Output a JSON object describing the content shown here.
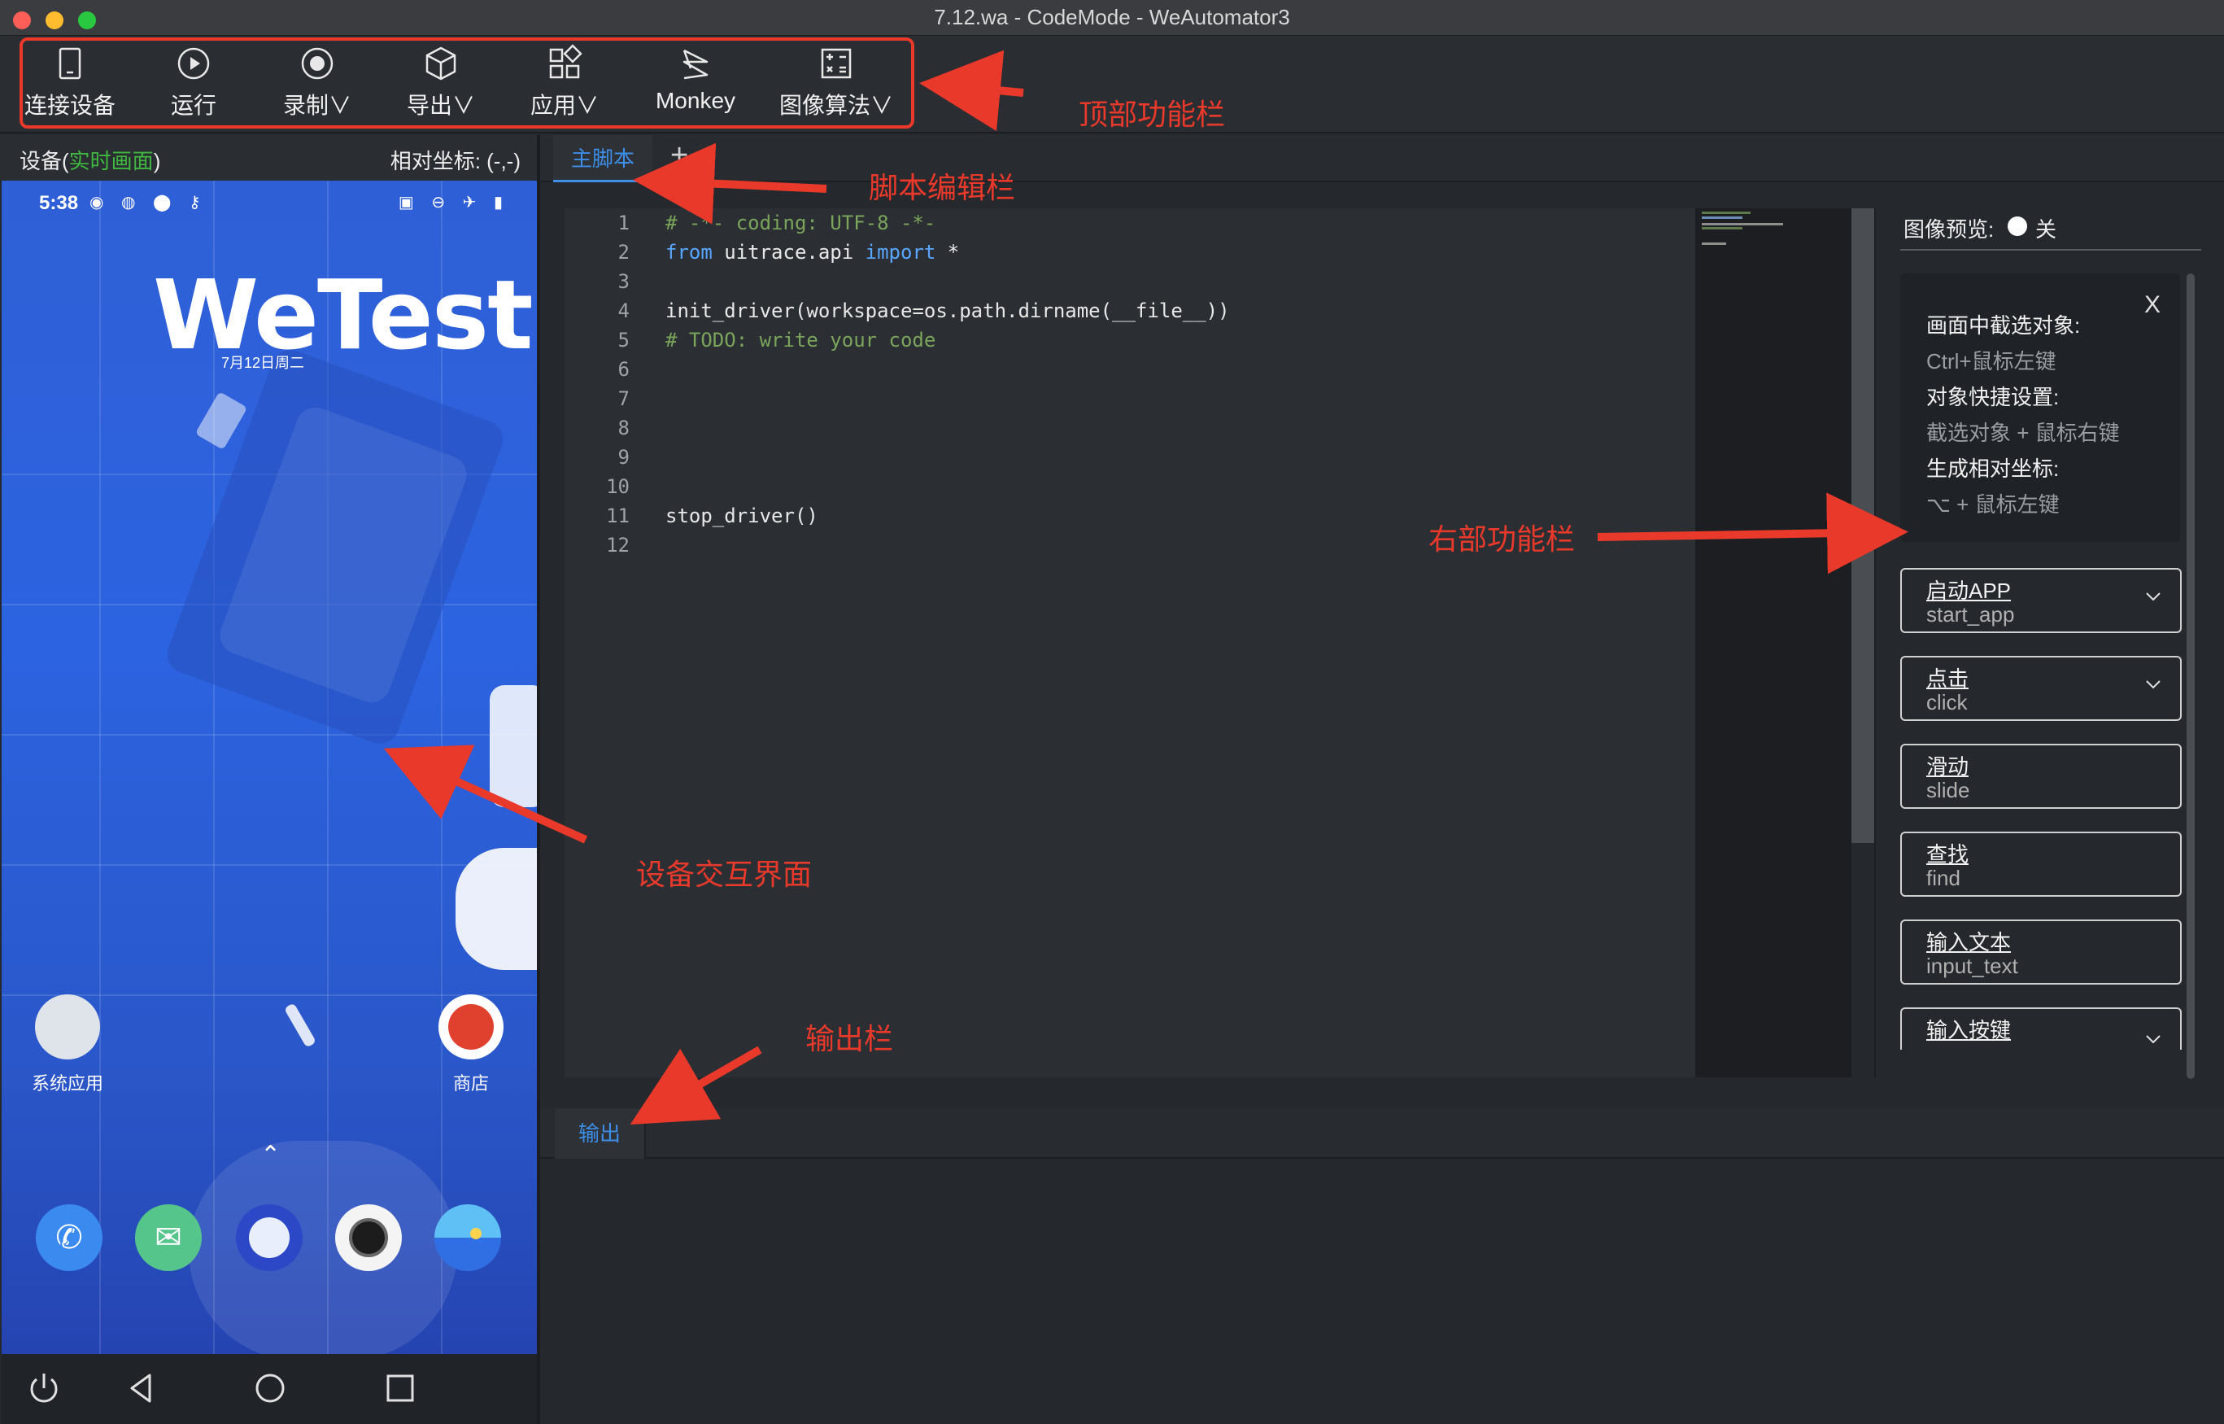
{
  "window": {
    "title": "7.12.wa - CodeMode - WeAutomator3"
  },
  "toolbar": {
    "items": [
      {
        "label": "连接设备",
        "icon": "tablet-icon"
      },
      {
        "label": "运行",
        "icon": "play-circle-icon"
      },
      {
        "label": "录制∨",
        "icon": "record-icon"
      },
      {
        "label": "导出∨",
        "icon": "package-icon"
      },
      {
        "label": "应用∨",
        "icon": "apps-grid-icon"
      },
      {
        "label": "Monkey",
        "icon": "monkey-icon"
      },
      {
        "label": "图像算法∨",
        "icon": "calculator-icon"
      }
    ]
  },
  "device": {
    "title_prefix": "设备(",
    "title_live": "实时画面",
    "title_suffix": ")",
    "coord_label": "相对坐标: (-,-)",
    "phone": {
      "time": "5:38",
      "logo_text": "WeTest",
      "date_text": "7月12日周二",
      "apps": [
        "系统应用",
        "商店"
      ]
    }
  },
  "editor": {
    "tabs": [
      "主脚本"
    ],
    "add_tab": "+",
    "lines": [
      {
        "n": "1",
        "text": "# -*- coding: UTF-8 -*-"
      },
      {
        "n": "2",
        "text": "from uitrace.api import *"
      },
      {
        "n": "3",
        "text": ""
      },
      {
        "n": "4",
        "text": "init_driver(workspace=os.path.dirname(__file__))"
      },
      {
        "n": "5",
        "text": "# TODO: write your code"
      },
      {
        "n": "6",
        "text": ""
      },
      {
        "n": "7",
        "text": ""
      },
      {
        "n": "8",
        "text": ""
      },
      {
        "n": "9",
        "text": ""
      },
      {
        "n": "10",
        "text": ""
      },
      {
        "n": "11",
        "text": "stop_driver()"
      },
      {
        "n": "12",
        "text": ""
      }
    ]
  },
  "right_panel": {
    "preview_label": "图像预览:",
    "preview_state": "关",
    "help": [
      {
        "title": "画面中截选对象:",
        "sub": "Ctrl+鼠标左键"
      },
      {
        "title": "对象快捷设置:",
        "sub": "截选对象 + 鼠标右键"
      },
      {
        "title": "生成相对坐标:",
        "sub": "⌥ + 鼠标左键"
      }
    ],
    "help_close": "X",
    "actions": [
      {
        "cn": "启动APP",
        "en": "start_app",
        "dropdown": true
      },
      {
        "cn": "点击",
        "en": "click",
        "dropdown": true
      },
      {
        "cn": "滑动",
        "en": "slide",
        "dropdown": false
      },
      {
        "cn": "查找",
        "en": "find",
        "dropdown": false
      },
      {
        "cn": "输入文本",
        "en": "input_text",
        "dropdown": false
      },
      {
        "cn": "输入按键",
        "en": "",
        "dropdown": true
      }
    ]
  },
  "output": {
    "tab": "输出"
  },
  "annotations": {
    "top_toolbar": "顶部功能栏",
    "script_editor": "脚本编辑栏",
    "right_panel": "右部功能栏",
    "device_ui": "设备交互界面",
    "output": "输出栏"
  },
  "colors": {
    "accent": "#3c8ee8",
    "annotation_red": "#e8392b",
    "live_green": "#3fb940",
    "comment_green": "#7aa55a",
    "keyword_blue": "#58a6ff"
  }
}
